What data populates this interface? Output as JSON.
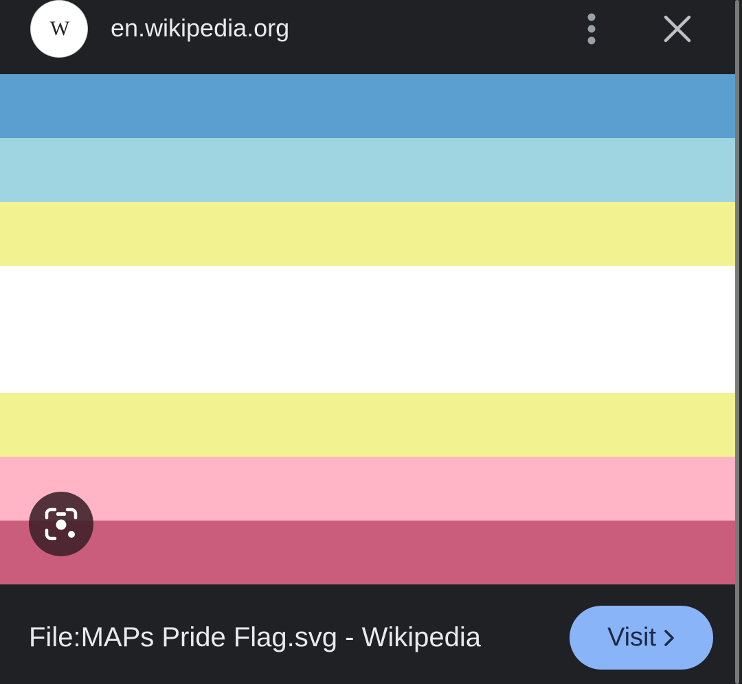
{
  "header": {
    "favicon_letter": "W",
    "domain": "en.wikipedia.org",
    "more_icon": "more-vert-icon",
    "close_icon": "close-icon"
  },
  "image": {
    "stripes": [
      {
        "color": "#5b9fd1",
        "weight": 1
      },
      {
        "color": "#9fd4e1",
        "weight": 1
      },
      {
        "color": "#f2f291",
        "weight": 1
      },
      {
        "color": "#ffffff",
        "weight": 2
      },
      {
        "color": "#f2f291",
        "weight": 1
      },
      {
        "color": "#ffb5c6",
        "weight": 1
      },
      {
        "color": "#cb5d7c",
        "weight": 1
      }
    ],
    "lens_icon": "lens-camera-icon"
  },
  "result": {
    "title": "File:MAPs Pride Flag.svg - Wikipedia",
    "visit_label": "Visit",
    "visit_icon": "chevron-right-icon"
  },
  "colors": {
    "background": "#202124",
    "accent": "#8ab4f8"
  }
}
